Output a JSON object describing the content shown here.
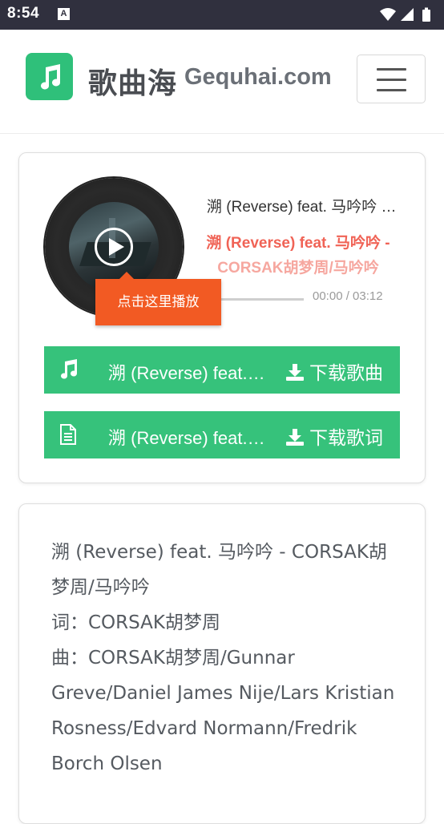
{
  "status_bar": {
    "time": "8:54",
    "notification_glyph": "A",
    "icons": [
      "wifi-icon",
      "signal-icon",
      "battery-icon"
    ]
  },
  "header": {
    "site_name_cn": "歌曲海",
    "site_name_en": "Gequhai.com",
    "logo_icon": "music-note-icon",
    "menu_icon": "hamburger-menu-icon"
  },
  "player": {
    "song_title": "溯 (Reverse) feat. 马吟吟 - CORSAK胡梦周/马吟吟",
    "lyric_line_1": "溯 (Reverse) feat. 马吟吟 -",
    "lyric_line_2": "CORSAK胡梦周/马吟吟",
    "time": "00:00 / 03:12",
    "tooltip": "点击这里播放",
    "download_song": {
      "name": "溯 (Reverse) feat. 马吟吟 - CORSAK胡梦周/马吟吟",
      "action": "下载歌曲"
    },
    "download_lyric": {
      "name": "溯 (Reverse) feat. 马吟吟 - CORSAK胡梦周/马吟吟",
      "action": "下载歌词"
    }
  },
  "lyrics": {
    "lines": [
      "溯 (Reverse) feat. 马吟吟 - CORSAK胡梦周/马吟吟",
      "词：CORSAK胡梦周",
      "曲：CORSAK胡梦周/Gunnar Greve/Daniel James Nije/Lars Kristian Rosness/Edvard Normann/Fredrik Borch Olsen"
    ]
  },
  "colors": {
    "status_bar": "#30303e",
    "brand_green": "#36c27b",
    "lyric_red": "#f06356",
    "tooltip_orange": "#f25a23"
  }
}
